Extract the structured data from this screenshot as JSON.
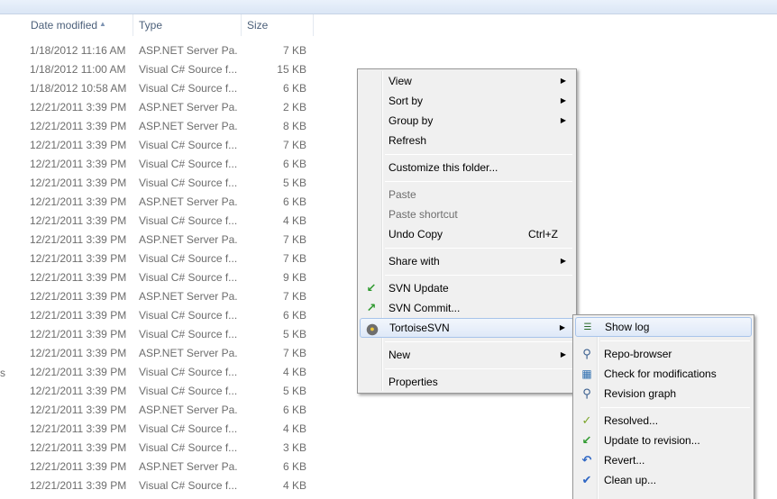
{
  "columns": {
    "date": "Date modified",
    "type": "Type",
    "size": "Size"
  },
  "rows": [
    {
      "date": "1/18/2012 11:16 AM",
      "type": "ASP.NET Server Pa...",
      "size": "7 KB"
    },
    {
      "date": "1/18/2012 11:00 AM",
      "type": "Visual C# Source f...",
      "size": "15 KB"
    },
    {
      "date": "1/18/2012 10:58 AM",
      "type": "Visual C# Source f...",
      "size": "6 KB"
    },
    {
      "date": "12/21/2011 3:39 PM",
      "type": "ASP.NET Server Pa...",
      "size": "2 KB"
    },
    {
      "date": "12/21/2011 3:39 PM",
      "type": "ASP.NET Server Pa...",
      "size": "8 KB"
    },
    {
      "date": "12/21/2011 3:39 PM",
      "type": "Visual C# Source f...",
      "size": "7 KB"
    },
    {
      "date": "12/21/2011 3:39 PM",
      "type": "Visual C# Source f...",
      "size": "6 KB"
    },
    {
      "date": "12/21/2011 3:39 PM",
      "type": "Visual C# Source f...",
      "size": "5 KB"
    },
    {
      "date": "12/21/2011 3:39 PM",
      "type": "ASP.NET Server Pa...",
      "size": "6 KB"
    },
    {
      "date": "12/21/2011 3:39 PM",
      "type": "Visual C# Source f...",
      "size": "4 KB"
    },
    {
      "date": "12/21/2011 3:39 PM",
      "type": "ASP.NET Server Pa...",
      "size": "7 KB"
    },
    {
      "date": "12/21/2011 3:39 PM",
      "type": "Visual C# Source f...",
      "size": "7 KB"
    },
    {
      "date": "12/21/2011 3:39 PM",
      "type": "Visual C# Source f...",
      "size": "9 KB"
    },
    {
      "date": "12/21/2011 3:39 PM",
      "type": "ASP.NET Server Pa...",
      "size": "7 KB"
    },
    {
      "date": "12/21/2011 3:39 PM",
      "type": "Visual C# Source f...",
      "size": "6 KB"
    },
    {
      "date": "12/21/2011 3:39 PM",
      "type": "Visual C# Source f...",
      "size": "5 KB"
    },
    {
      "date": "12/21/2011 3:39 PM",
      "type": "ASP.NET Server Pa...",
      "size": "7 KB"
    },
    {
      "date": "12/21/2011 3:39 PM",
      "type": "Visual C# Source f...",
      "size": "4 KB"
    },
    {
      "date": "12/21/2011 3:39 PM",
      "type": "Visual C# Source f...",
      "size": "5 KB"
    },
    {
      "date": "12/21/2011 3:39 PM",
      "type": "ASP.NET Server Pa...",
      "size": "6 KB"
    },
    {
      "date": "12/21/2011 3:39 PM",
      "type": "Visual C# Source f...",
      "size": "4 KB"
    },
    {
      "date": "12/21/2011 3:39 PM",
      "type": "Visual C# Source f...",
      "size": "3 KB"
    },
    {
      "date": "12/21/2011 3:39 PM",
      "type": "ASP.NET Server Pa...",
      "size": "6 KB"
    },
    {
      "date": "12/21/2011 3:39 PM",
      "type": "Visual C# Source f...",
      "size": "4 KB"
    }
  ],
  "edge_glyph": "s",
  "context_menu": {
    "view": "View",
    "sort_by": "Sort by",
    "group_by": "Group by",
    "refresh": "Refresh",
    "customize": "Customize this folder...",
    "paste": "Paste",
    "paste_shortcut": "Paste shortcut",
    "undo_copy": "Undo Copy",
    "undo_copy_shortcut": "Ctrl+Z",
    "share_with": "Share with",
    "svn_update": "SVN Update",
    "svn_commit": "SVN Commit...",
    "tortoise_svn": "TortoiseSVN",
    "new": "New",
    "properties": "Properties"
  },
  "tortoise_submenu": {
    "show_log": "Show log",
    "repo_browser": "Repo-browser",
    "check_mods": "Check for modifications",
    "revision_graph": "Revision graph",
    "resolved": "Resolved...",
    "update_to_revision": "Update to revision...",
    "revert": "Revert...",
    "clean_up": "Clean up..."
  },
  "colors": {
    "menu_background": "#f0f0f0",
    "highlight_border": "#a8c4ea",
    "row_text": "#6d6d6d",
    "header_text": "#4c607a"
  },
  "icons": {
    "submenu_arrow": "chevron-right-icon",
    "svn_update": "green-arrow-down-icon",
    "svn_commit": "green-arrow-up-icon",
    "tortoise_svn": "tortoise-icon"
  }
}
